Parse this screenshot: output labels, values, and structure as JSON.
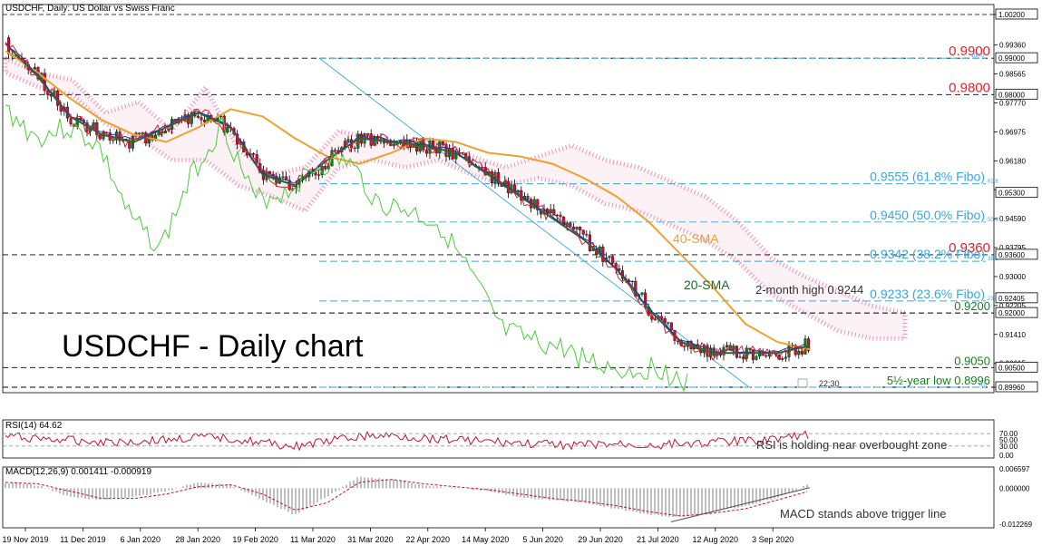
{
  "header": {
    "title": "USDCHF, Daily:  US Dollar vs Swiss Franc",
    "chart_title": "USDCHF - Daily chart",
    "clock": "22:30"
  },
  "colors": {
    "bull": "#0a7d1e",
    "bear": "#c8102e",
    "sma20": "#1e6b2a",
    "sma40": "#f0a030",
    "kijun": "#1f2fbf",
    "tenkan": "#d02030",
    "chikou": "#4ccc3a",
    "cloud": "#e98ab0",
    "fibo": "#3aa6e0",
    "level_red": "#e0242a",
    "level_green": "#15801f",
    "rsi": "#c8102e",
    "macd_hist": "#b0b0b0",
    "macd_signal": "#c8102e"
  },
  "annotations": {
    "sma40": "40-SMA",
    "sma20": "20-SMA",
    "high": "2-month high 0.9244",
    "rsi": "RSI is holding near overbought zone",
    "macd": "MACD stands above trigger line"
  },
  "chart_data": [
    {
      "type": "candlestick",
      "panel": "price",
      "title": "USDCHF, Daily:  US Dollar vs Swiss Franc",
      "ylim": [
        0.8996,
        1.002
      ],
      "y_ticks": [
        "1.00200",
        "0.99360",
        "0.98565",
        "0.97770",
        "0.96975",
        "0.96180",
        "0.95385",
        "0.94590",
        "0.93795",
        "0.93000",
        "0.92205",
        "0.91410",
        "0.90615",
        "0.89960"
      ],
      "highlighted_ticks": [
        {
          "label": "1.00200",
          "value": 1.002
        },
        {
          "label": "0.99000",
          "value": 0.99
        },
        {
          "label": "0.98000",
          "value": 0.98
        },
        {
          "label": "0.95300",
          "value": 0.953
        },
        {
          "label": "0.93600",
          "value": 0.936
        },
        {
          "label": "0.92405",
          "value": 0.92405
        },
        {
          "label": "0.92000",
          "value": 0.92
        },
        {
          "label": "0.90500",
          "value": 0.905
        },
        {
          "label": "0.89960",
          "value": 0.8996
        }
      ],
      "x_tick_labels": [
        "19 Nov 2019",
        "11 Dec 2019",
        "6 Jan 2020",
        "28 Jan 2020",
        "19 Feb 2020",
        "11 Mar 2020",
        "31 Mar 2020",
        "22 Apr 2020",
        "14 May 2020",
        "5 Jun 2020",
        "29 Jun 2020",
        "21 Jul 2020",
        "12 Aug 2020",
        "3 Sep 2020"
      ],
      "horizontal_levels": [
        {
          "label": "0.9900",
          "value": 0.99,
          "color": "red"
        },
        {
          "label": "0.9800",
          "value": 0.98,
          "color": "red"
        },
        {
          "label": "0.9360",
          "value": 0.936,
          "color": "red"
        },
        {
          "label": "0.9200",
          "value": 0.92,
          "color": "green"
        },
        {
          "label": "0.9050",
          "value": 0.905,
          "color": "green"
        },
        {
          "label": "5½-year low 0.8996",
          "value": 0.8996,
          "color": "green"
        }
      ],
      "fibonacci_levels": [
        {
          "label": "0.9555 (61.8% Fibo)",
          "value": 0.9555,
          "tag": "61.8"
        },
        {
          "label": "0.9450 (50.0% Fibo)",
          "value": 0.945,
          "tag": "50.0"
        },
        {
          "label": "0.9342 (38.2% Fibo)",
          "value": 0.9342,
          "tag": "38.2"
        },
        {
          "label": "0.9233 (23.6% Fibo)",
          "value": 0.9233,
          "tag": "23.6"
        }
      ],
      "fibonacci_range_tags": [
        "100.0",
        "0.0"
      ],
      "series": [
        {
          "name": "40-SMA",
          "values": [
            0.992,
            0.986,
            0.979,
            0.973,
            0.969,
            0.967,
            0.971,
            0.976,
            0.974,
            0.968,
            0.963,
            0.961,
            0.964,
            0.968,
            0.967,
            0.964,
            0.963,
            0.961,
            0.957,
            0.952,
            0.945,
            0.936,
            0.927,
            0.917,
            0.912,
            0.91
          ]
        },
        {
          "name": "20-SMA",
          "values": [
            0.994,
            0.985,
            0.974,
            0.969,
            0.967,
            0.971,
            0.975,
            0.971,
            0.958,
            0.955,
            0.962,
            0.968,
            0.967,
            0.966,
            0.964,
            0.958,
            0.952,
            0.946,
            0.94,
            0.932,
            0.921,
            0.912,
            0.909,
            0.909,
            0.909,
            0.911
          ]
        }
      ]
    },
    {
      "type": "line",
      "panel": "RSI",
      "title": "RSI(14) 64.62",
      "ylim": [
        0,
        100
      ],
      "y_ticks": [
        "70.00",
        "50.00",
        "30.00",
        "0.00"
      ],
      "values": [
        62,
        55,
        48,
        45,
        44,
        50,
        58,
        55,
        40,
        28,
        45,
        60,
        63,
        56,
        52,
        44,
        38,
        34,
        33,
        35,
        32,
        38,
        42,
        46,
        56,
        64.62
      ]
    },
    {
      "type": "bar",
      "panel": "MACD",
      "title": "MACD(12,26,9) 0.001411 -0.000919",
      "ylim": [
        -0.012269,
        0.006597
      ],
      "y_ticks": [
        "0.006597",
        "0.000000",
        "-0.012269"
      ],
      "series": [
        {
          "name": "MACD",
          "values": [
            0.002,
            0.001,
            -0.003,
            -0.004,
            -0.003,
            -0.001,
            0.002,
            0.001,
            -0.004,
            -0.009,
            -0.003,
            0.004,
            0.003,
            0.001,
            0.0,
            -0.001,
            -0.003,
            -0.004,
            -0.005,
            -0.007,
            -0.009,
            -0.01,
            -0.008,
            -0.006,
            -0.003,
            0.001411
          ]
        },
        {
          "name": "Signal",
          "values": [
            0.002,
            0.0015,
            -0.001,
            -0.0035,
            -0.0035,
            -0.002,
            0.0005,
            0.0012,
            -0.002,
            -0.0075,
            -0.005,
            0.002,
            0.003,
            0.0015,
            0.0005,
            -0.0005,
            -0.002,
            -0.0035,
            -0.0045,
            -0.006,
            -0.008,
            -0.0095,
            -0.0085,
            -0.007,
            -0.004,
            -0.000919
          ]
        }
      ]
    }
  ]
}
